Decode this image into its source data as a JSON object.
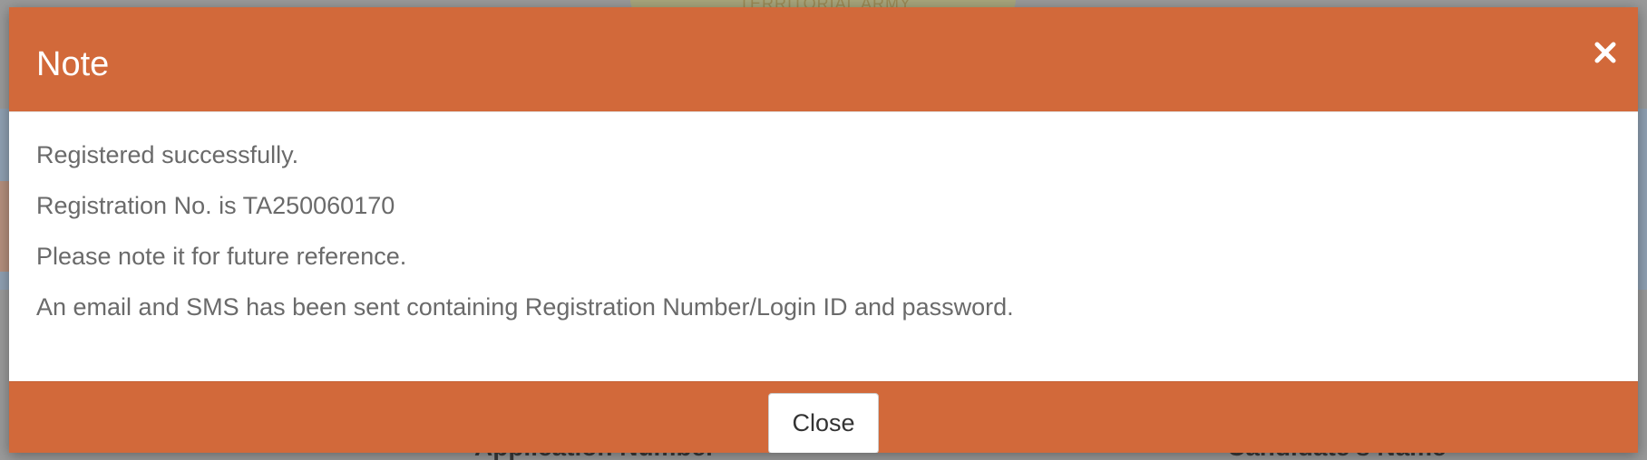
{
  "modal": {
    "title": "Note",
    "close_icon": "close-icon",
    "body_lines": [
      "Registered successfully.",
      "Registration No. is TA250060170",
      "Please note it for future reference.",
      "An email and SMS has been sent containing Registration Number/Login ID and password."
    ],
    "footer": {
      "close_label": "Close"
    }
  },
  "background": {
    "banner_text": "TERRITORIAL ARMY",
    "column_headers": [
      "Application Number",
      "Candidate's Name"
    ]
  },
  "colors": {
    "accent": "#d2693a",
    "body_text": "#6a6a6a",
    "button_text": "#333333"
  }
}
